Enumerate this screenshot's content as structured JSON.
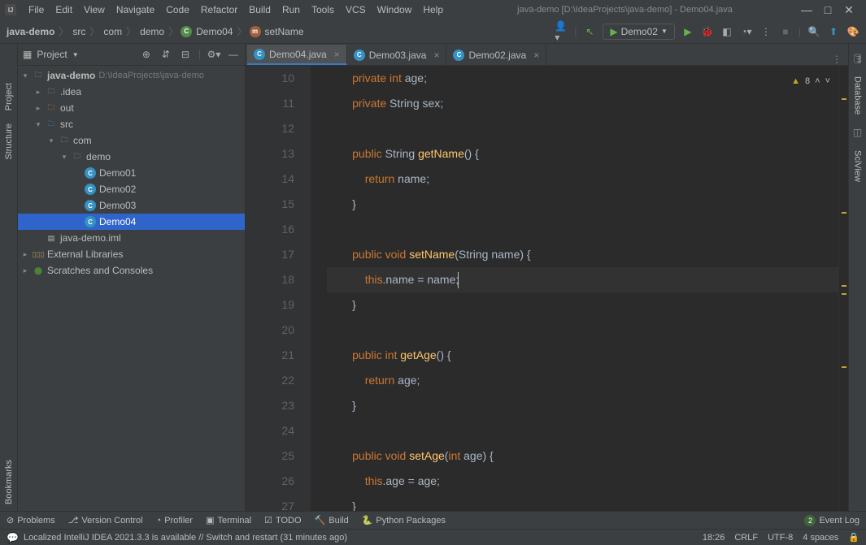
{
  "window": {
    "title": "java-demo [D:\\IdeaProjects\\java-demo] - Demo04.java"
  },
  "menus": [
    "File",
    "Edit",
    "View",
    "Navigate",
    "Code",
    "Refactor",
    "Build",
    "Run",
    "Tools",
    "VCS",
    "Window",
    "Help"
  ],
  "breadcrumb": {
    "project": "java-demo",
    "p1": "src",
    "p2": "com",
    "p3": "demo",
    "cls": "Demo04",
    "method": "setName"
  },
  "runConfig": "Demo02",
  "toolbarIcons": {
    "user": "user-icon",
    "hammer": "build-icon",
    "play": "run-icon",
    "bug": "debug-icon",
    "coverage": "coverage-icon",
    "profile": "profile-icon",
    "stop": "stop-icon",
    "search": "search-icon",
    "sync": "sync-icon",
    "ide": "ide-icon"
  },
  "projectPanel": {
    "title": "Project"
  },
  "tree": {
    "root": "java-demo",
    "rootPath": "D:\\IdeaProjects\\java-demo",
    "idea": ".idea",
    "out": "out",
    "src": "src",
    "com": "com",
    "demo": "demo",
    "d1": "Demo01",
    "d2": "Demo02",
    "d3": "Demo03",
    "d4": "Demo04",
    "iml": "java-demo.iml",
    "extLib": "External Libraries",
    "scratch": "Scratches and Consoles"
  },
  "tabs": {
    "t1": "Demo04.java",
    "t2": "Demo03.java",
    "t3": "Demo02.java"
  },
  "warnings": "8",
  "code": {
    "startLine": 10,
    "lines": [
      {
        "n": 10,
        "i": 2,
        "k1": "private",
        "sp1": " ",
        "k2": "int",
        "sp2": " ",
        "id": "age",
        "end": ";"
      },
      {
        "n": 11,
        "i": 2,
        "k1": "private",
        "sp1": " ",
        "id1": "String",
        "sp2": " ",
        "id2": "sex",
        "end": ";"
      },
      {
        "n": 12,
        "i": 0,
        "text": ""
      },
      {
        "n": 13,
        "i": 2,
        "k1": "public",
        "sp1": " ",
        "id1": "String",
        "sp2": " ",
        "m": "getName",
        "rest": "() {",
        "fold": "-"
      },
      {
        "n": 14,
        "i": 3,
        "k1": "return",
        "sp1": " ",
        "id": "name",
        "end": ";"
      },
      {
        "n": 15,
        "i": 2,
        "text": "}",
        "fold": "-"
      },
      {
        "n": 16,
        "i": 0,
        "text": ""
      },
      {
        "n": 17,
        "i": 2,
        "k1": "public",
        "sp1": " ",
        "k2": "void",
        "sp2": " ",
        "m": "setName",
        "rest": "(String name) {",
        "fold": "-"
      },
      {
        "n": 18,
        "i": 3,
        "k1": "this",
        "rest": ".name = name;",
        "current": true
      },
      {
        "n": 19,
        "i": 2,
        "text": "}",
        "fold": "-"
      },
      {
        "n": 20,
        "i": 0,
        "text": ""
      },
      {
        "n": 21,
        "i": 2,
        "k1": "public",
        "sp1": " ",
        "k2": "int",
        "sp2": " ",
        "m": "getAge",
        "rest": "() {",
        "fold": "-"
      },
      {
        "n": 22,
        "i": 3,
        "k1": "return",
        "sp1": " ",
        "id": "age",
        "end": ";"
      },
      {
        "n": 23,
        "i": 2,
        "text": "}",
        "fold": "-"
      },
      {
        "n": 24,
        "i": 0,
        "text": ""
      },
      {
        "n": 25,
        "i": 2,
        "k1": "public",
        "sp1": " ",
        "k2": "void",
        "sp2": " ",
        "m": "setAge",
        "rest": "(",
        "k3": "int",
        "rest2": " age) {",
        "fold": "-"
      },
      {
        "n": 26,
        "i": 3,
        "k1": "this",
        "rest": ".age = age;"
      },
      {
        "n": 27,
        "i": 2,
        "text": "}",
        "fold": "-"
      }
    ]
  },
  "bottomTools": {
    "problems": "Problems",
    "vcs": "Version Control",
    "profiler": "Profiler",
    "terminal": "Terminal",
    "todo": "TODO",
    "build": "Build",
    "python": "Python Packages",
    "eventLog": "Event Log"
  },
  "statusBar": {
    "msg": "Localized IntelliJ IDEA 2021.3.3 is available // Switch and restart (31 minutes ago)",
    "pos": "18:26",
    "sep": "CRLF",
    "enc": "UTF-8",
    "indent": "4 spaces"
  },
  "sideTools": {
    "project": "Project",
    "structure": "Structure",
    "bookmarks": "Bookmarks",
    "database": "Database",
    "sciview": "SciView"
  }
}
